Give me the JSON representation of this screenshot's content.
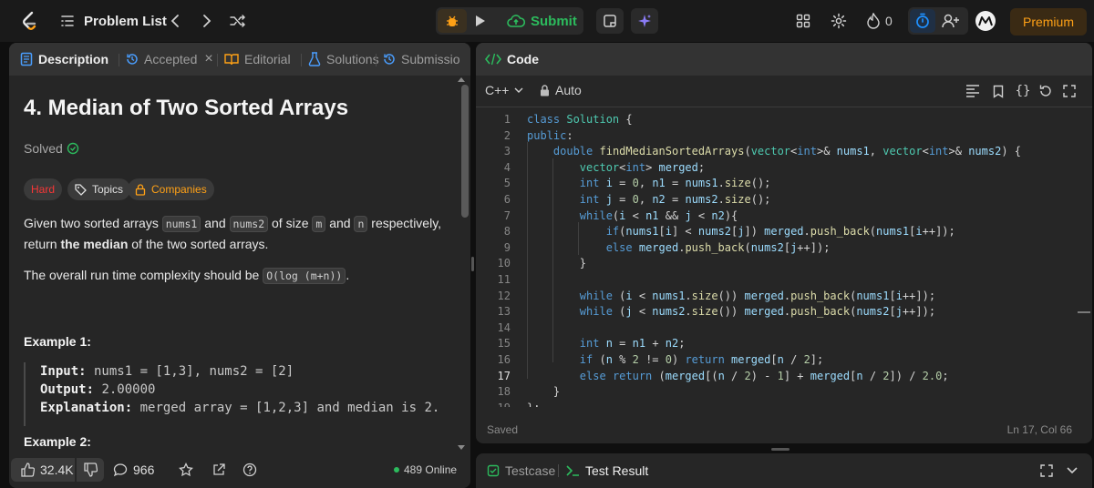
{
  "colors": {
    "accent": "#ffa116",
    "submit_green": "#2cbb5d",
    "hard": "#f63737",
    "link_blue": "#4a9eff",
    "timer_blue": "#1e90ff"
  },
  "topbar": {
    "logo_icon": "leetcode-logo",
    "problem_list_label": "Problem List",
    "submit_label": "Submit",
    "streak_count": "0",
    "premium_label": "Premium"
  },
  "description_tabs": [
    {
      "label": "Description",
      "icon": "document-icon"
    },
    {
      "label": "Accepted",
      "icon": "history-icon"
    },
    {
      "label": "Editorial",
      "icon": "book-icon"
    },
    {
      "label": "Solutions",
      "icon": "flask-icon"
    },
    {
      "label": "Submissio",
      "icon": "history-icon"
    }
  ],
  "problem": {
    "title": "4. Median of Two Sorted Arrays",
    "status": "Solved",
    "difficulty": "Hard",
    "topics_label": "Topics",
    "companies_label": "Companies",
    "statement": {
      "p1_a": "Given two sorted arrays ",
      "nums1": "nums1",
      "p1_b": " and ",
      "nums2": "nums2",
      "p1_c": " of size ",
      "m": "m",
      "p1_d": " and ",
      "n": "n",
      "p1_e": " respectively,",
      "p1_f": "return ",
      "p1_bold": "the median",
      "p1_g": " of the two sorted arrays.",
      "p2_a": "The overall run time complexity should be ",
      "complexity": "O(log (m+n))",
      "p2_b": "."
    },
    "example1": {
      "title": "Example 1:",
      "input_label": "Input:",
      "input_value": " nums1 = [1,3], nums2 = [2]",
      "output_label": "Output:",
      "output_value": " 2.00000",
      "explanation_label": "Explanation:",
      "explanation_value": " merged array = [1,2,3] and median is 2."
    },
    "example2_title": "Example 2:"
  },
  "desc_footer": {
    "likes": "32.4K",
    "comments": "966",
    "online": "489 Online"
  },
  "code_panel": {
    "header_label": "Code",
    "language": "C++",
    "mode": "Auto",
    "saved": "Saved",
    "cursor": "Ln 17, Col 66"
  },
  "code_lines": [
    "class Solution {",
    "public:",
    "    double findMedianSortedArrays(vector<int>& nums1, vector<int>& nums2) {",
    "        vector<int> merged;",
    "        int i = 0, n1 = nums1.size();",
    "        int j = 0, n2 = nums2.size();",
    "        while(i < n1 && j < n2){",
    "            if(nums1[i] < nums2[j]) merged.push_back(nums1[i++]);",
    "            else merged.push_back(nums2[j++]);",
    "        }",
    "",
    "        while (i < nums1.size()) merged.push_back(nums1[i++]);",
    "        while (j < nums2.size()) merged.push_back(nums2[j++]);",
    "",
    "        int n = n1 + n2;",
    "        if (n % 2 != 0) return merged[n / 2];",
    "        else return (merged[(n / 2) - 1] + merged[n / 2]) / 2.0;",
    "    }",
    "};"
  ],
  "active_line": 17,
  "test_panel": {
    "testcase_label": "Testcase",
    "result_label": "Test Result"
  }
}
